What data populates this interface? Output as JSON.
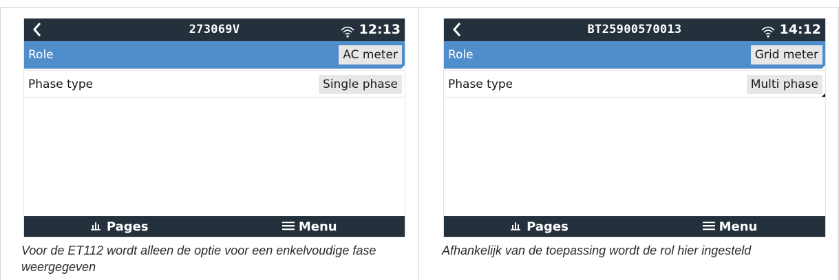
{
  "screens": [
    {
      "title": "273069V",
      "time": "12:13",
      "rows": [
        {
          "label": "Role",
          "value": "AC meter"
        },
        {
          "label": "Phase type",
          "value": "Single phase"
        }
      ],
      "bottom": {
        "pages": "Pages",
        "menu": "Menu"
      },
      "caption": "Voor de ET112 wordt alleen de optie voor een enkelvoudige fase weergegeven"
    },
    {
      "title": "BT25900570013",
      "time": "14:12",
      "rows": [
        {
          "label": "Role",
          "value": "Grid meter"
        },
        {
          "label": "Phase type",
          "value": "Multi phase"
        }
      ],
      "bottom": {
        "pages": "Pages",
        "menu": "Menu"
      },
      "caption": "Afhankelijk van de toepassing wordt de rol hier ingesteld"
    }
  ],
  "icons": {
    "back": "chevron-left-icon",
    "wifi": "wifi-icon",
    "pages": "bar-chart-icon",
    "menu": "hamburger-menu-icon"
  },
  "colors": {
    "titlebar": "#24303b",
    "selected_row": "#4f8dcb",
    "value_box": "#e7e7e7"
  }
}
